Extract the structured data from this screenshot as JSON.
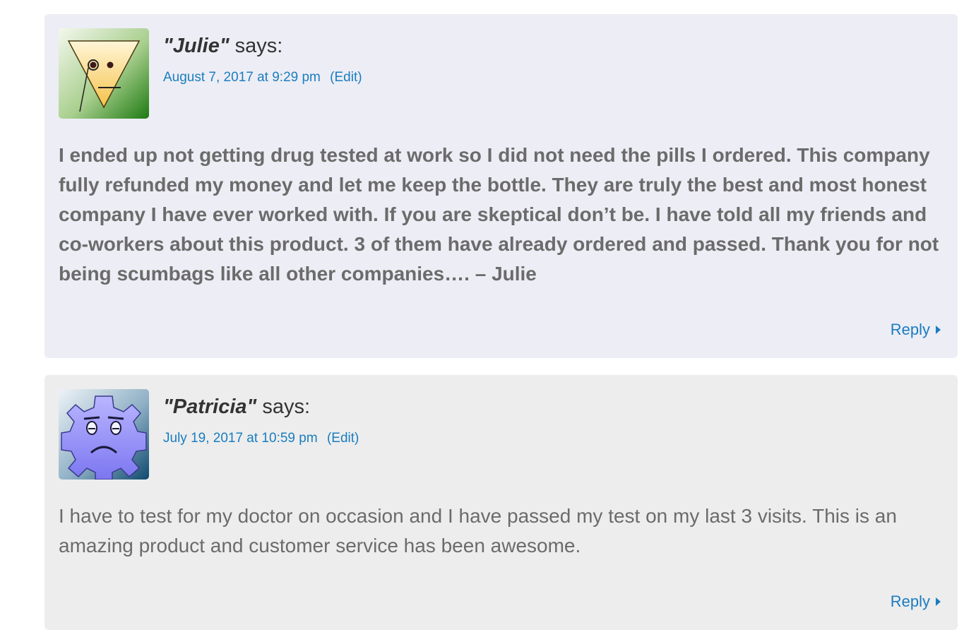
{
  "comments": [
    {
      "author": "\"Julie\"",
      "says": "says:",
      "date": "August 7, 2017 at 9:29 pm",
      "edit_label": "(Edit)",
      "avatar_icon": "wavatar-triangle-face-icon",
      "background": "#ededf5",
      "text": "I ended up not getting drug tested at work so I did not need the pills I ordered. This company fully refunded my money and let me keep the bottle. They are truly the best and most honest company I have ever worked with. If you are skeptical don’t be. I have told all my friends and co-workers about this product. 3 of them have already ordered and passed. Thank you for not being scumbags like all other companies…. – Julie",
      "reply_label": "Reply"
    },
    {
      "author": "\"Patricia\"",
      "says": "says:",
      "date": "July 19, 2017 at 10:59 pm",
      "edit_label": "(Edit)",
      "avatar_icon": "wavatar-gear-face-icon",
      "background": "#ededed",
      "text": "I have to test for my doctor on occasion and I have passed my test on my last 3 visits. This is an amazing product and customer service has been awesome.",
      "reply_label": "Reply"
    }
  ],
  "colors": {
    "link": "#1a7dc0",
    "body_text": "#6b6b6b",
    "author_text": "#333333"
  }
}
